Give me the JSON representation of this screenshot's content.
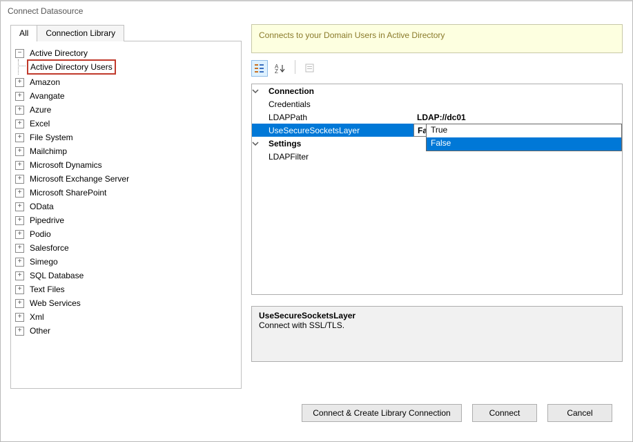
{
  "window": {
    "title": "Connect Datasource"
  },
  "tabs": {
    "all": "All",
    "library": "Connection Library"
  },
  "tree": {
    "root": "Active Directory",
    "root_child": "Active Directory Users",
    "nodes": [
      "Amazon",
      "Avangate",
      "Azure",
      "Excel",
      "File System",
      "Mailchimp",
      "Microsoft Dynamics",
      "Microsoft Exchange Server",
      "Microsoft SharePoint",
      "OData",
      "Pipedrive",
      "Podio",
      "Salesforce",
      "Simego",
      "SQL Database",
      "Text Files",
      "Web Services",
      "Xml",
      "Other"
    ]
  },
  "banner": {
    "text": "Connects to your Domain Users in Active Directory"
  },
  "grid": {
    "group_connection": "Connection",
    "prop_credentials": "Credentials",
    "prop_ldappath": "LDAPPath",
    "val_ldappath": "LDAP://dc01",
    "prop_usessl": "UseSecureSocketsLayer",
    "val_usessl": "False",
    "group_settings": "Settings",
    "prop_ldapfilter": "LDAPFilter",
    "dropdown": {
      "opt_true": "True",
      "opt_false": "False"
    }
  },
  "description": {
    "title": "UseSecureSocketsLayer",
    "text": "Connect with SSL/TLS."
  },
  "buttons": {
    "create": "Connect & Create Library Connection",
    "connect": "Connect",
    "cancel": "Cancel"
  }
}
